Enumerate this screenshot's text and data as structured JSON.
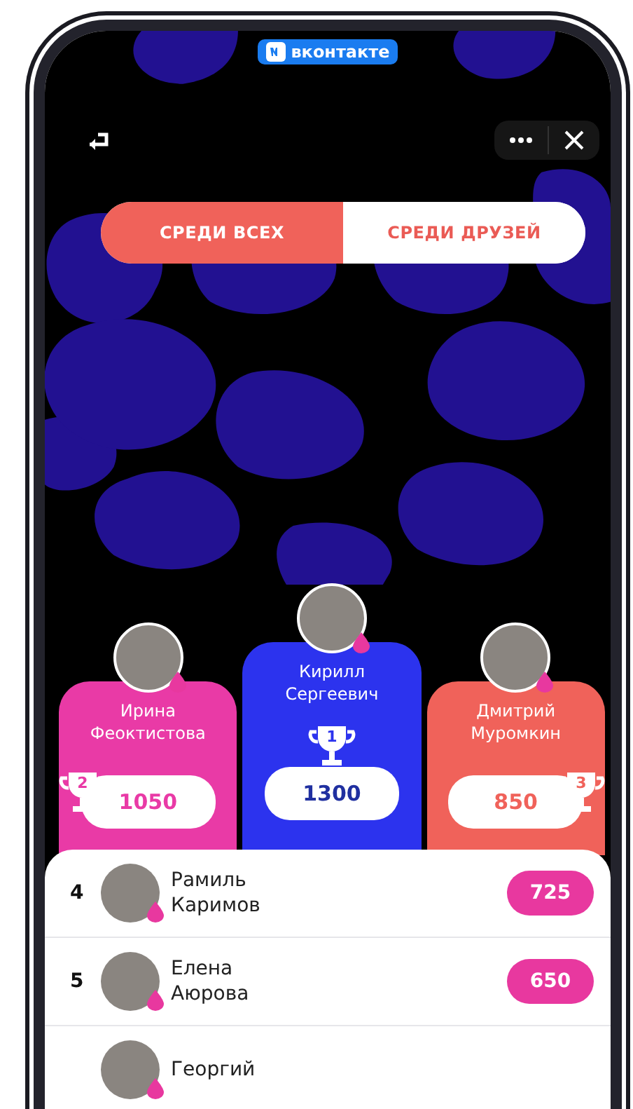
{
  "app_badge": {
    "label": "вконтакте"
  },
  "tabs": [
    {
      "label": "СРЕДИ ВСЕХ",
      "selected": true
    },
    {
      "label": "СРЕДИ ДРУЗЕЙ",
      "selected": false
    }
  ],
  "podium": [
    {
      "kind": "second",
      "place": "2",
      "name": "Ирина Феоктистова",
      "score": "1050",
      "color": "#e93aa6"
    },
    {
      "kind": "first",
      "place": "1",
      "name": "Кирилл Сергеевич",
      "score": "1300",
      "color": "#2c33ee"
    },
    {
      "kind": "third",
      "place": "3",
      "name": "Дмитрий Муромкин",
      "score": "850",
      "color": "#f0625a"
    }
  ],
  "rows": [
    {
      "rank": "4",
      "name": "Рамиль Каримов",
      "score": "725"
    },
    {
      "rank": "5",
      "name": "Елена Аюрова",
      "score": "650"
    },
    {
      "name": "Георгий"
    }
  ]
}
